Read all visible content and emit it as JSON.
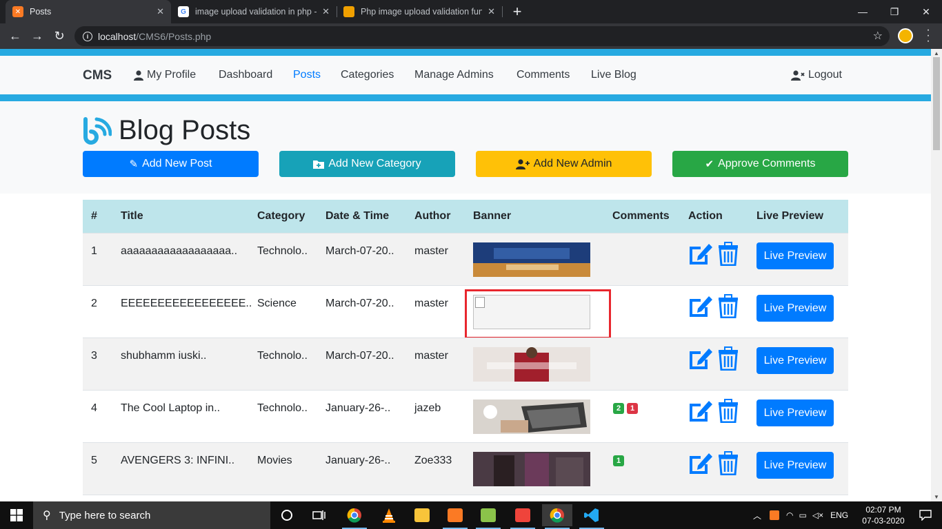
{
  "browser": {
    "tabs": [
      {
        "title": "Posts",
        "favicon_color": "#fb7a24",
        "active": true
      },
      {
        "title": "image upload validation in php -",
        "favicon_color": "#ffffff",
        "active": false
      },
      {
        "title": "Php image upload validation func",
        "favicon_color": "#f0a000",
        "active": false
      }
    ],
    "url_host": "localhost",
    "url_path": "/CMS6/Posts.php"
  },
  "navbar": {
    "brand": "CMS",
    "links": [
      "My Profile",
      "Dashboard",
      "Posts",
      "Categories",
      "Manage Admins",
      "Comments",
      "Live Blog"
    ],
    "active_link": "Posts",
    "logout": "Logout"
  },
  "header": {
    "title": "Blog Posts",
    "buttons": [
      "Add New Post",
      "Add New Category",
      "Add New Admin",
      "Approve Comments"
    ]
  },
  "table": {
    "headers": [
      "#",
      "Title",
      "Category",
      "Date & Time",
      "Author",
      "Banner",
      "Comments",
      "Action",
      "Live Preview"
    ],
    "rows": [
      {
        "num": "1",
        "title": "aaaaaaaaaaaaaaaaaa..",
        "category": "Technolo..",
        "date": "March-07-20..",
        "author": "master",
        "banner": "movie-poster",
        "approved": "",
        "pending": "",
        "preview": "Live Preview"
      },
      {
        "num": "2",
        "title": "EEEEEEEEEEEEEEEEE..",
        "category": "Science",
        "date": "March-07-20..",
        "author": "master",
        "banner": "broken",
        "approved": "",
        "pending": "",
        "preview": "Live Preview"
      },
      {
        "num": "3",
        "title": "shubhamm iuski..",
        "category": "Technolo..",
        "date": "March-07-20..",
        "author": "master",
        "banner": "alibaba",
        "approved": "",
        "pending": "",
        "preview": "Live Preview"
      },
      {
        "num": "4",
        "title": "The Cool Laptop in..",
        "category": "Technolo..",
        "date": "January-26-..",
        "author": "jazeb",
        "banner": "laptop",
        "approved": "2",
        "pending": "1",
        "preview": "Live Preview"
      },
      {
        "num": "5",
        "title": "AVENGERS 3: INFINI..",
        "category": "Movies",
        "date": "January-26-..",
        "author": "Zoe333",
        "banner": "avengers",
        "approved": "1",
        "pending": "",
        "preview": "Live Preview"
      }
    ]
  },
  "taskbar": {
    "search_placeholder": "Type here to search",
    "language": "ENG",
    "time": "02:07 PM",
    "date": "07-03-2020"
  },
  "colors": {
    "accent_blue": "#27aae1",
    "primary": "#007bff",
    "info": "#17a2b8",
    "warning": "#ffc107",
    "success": "#28a745",
    "danger": "#dc3545",
    "highlight_box": "#e8262d"
  }
}
